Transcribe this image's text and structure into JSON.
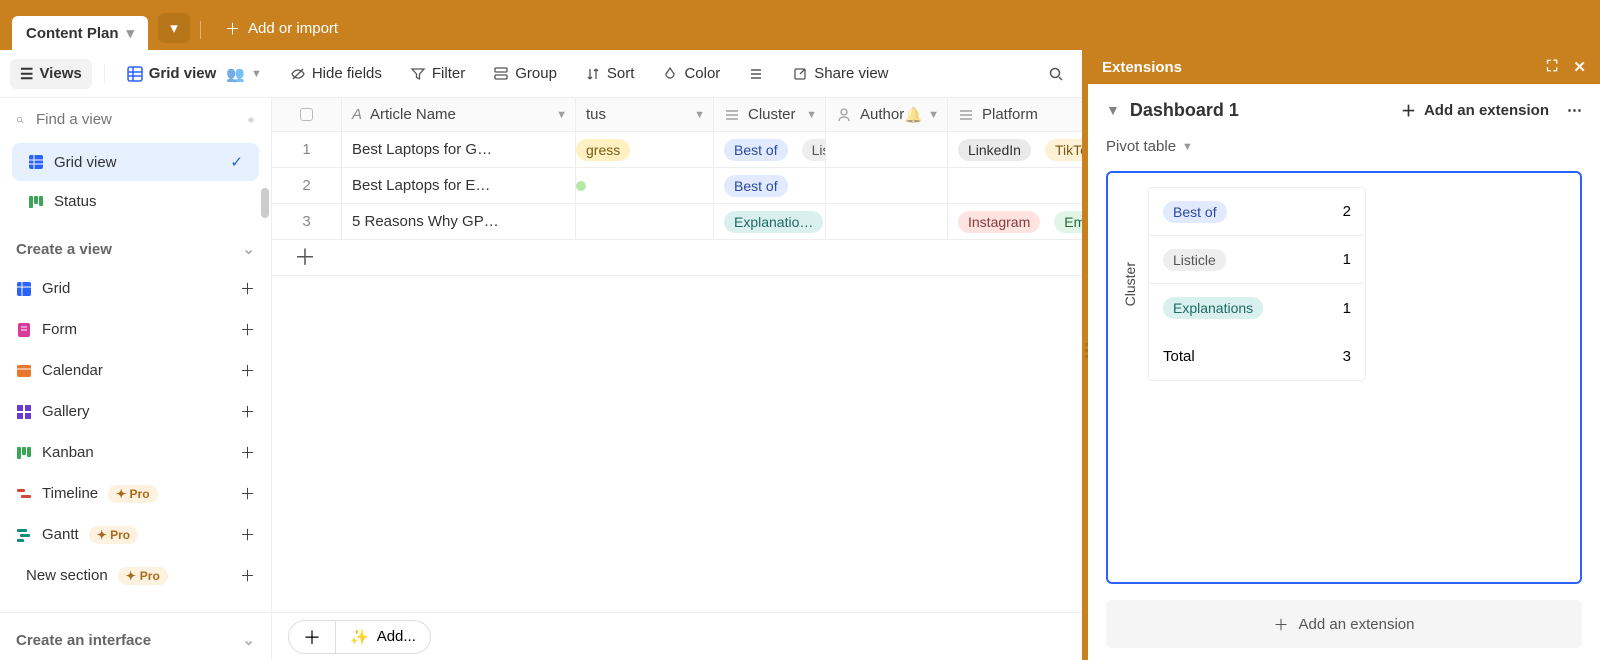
{
  "topbar": {
    "table_tab": "Content Plan",
    "add_or_import": "Add or import"
  },
  "toolbar": {
    "views": "Views",
    "grid_view": "Grid view",
    "hide_fields": "Hide fields",
    "filter": "Filter",
    "group": "Group",
    "sort": "Sort",
    "color": "Color",
    "share": "Share view"
  },
  "sidebar": {
    "search_placeholder": "Find a view",
    "views": [
      {
        "label": "Grid view",
        "active": true
      },
      {
        "label": "Status",
        "active": false
      }
    ],
    "create_view_header": "Create a view",
    "view_types": [
      {
        "label": "Grid",
        "color": "#2a62ff",
        "pro": false
      },
      {
        "label": "Form",
        "color": "#d63a9a",
        "pro": false
      },
      {
        "label": "Calendar",
        "color": "#e8762d",
        "pro": false
      },
      {
        "label": "Gallery",
        "color": "#6a3ad6",
        "pro": false
      },
      {
        "label": "Kanban",
        "color": "#3aa655",
        "pro": false
      },
      {
        "label": "Timeline",
        "color": "#d6453a",
        "pro": true
      },
      {
        "label": "Gantt",
        "color": "#0f8f79",
        "pro": true
      }
    ],
    "new_section": "New section",
    "pro_label": "Pro",
    "create_interface": "Create an interface"
  },
  "grid": {
    "columns": {
      "article_name": "Article Name",
      "status_partial": "tus",
      "cluster": "Cluster",
      "author": "Author",
      "platform": "Platform"
    },
    "rows": [
      {
        "num": "1",
        "name": "Best Laptops for G…",
        "status": {
          "text": "gress",
          "kind": "progress"
        },
        "cluster_tags": [
          {
            "text": "Best of",
            "kind": "bestof"
          },
          {
            "text": "Listi",
            "kind": "listicle"
          }
        ],
        "platform_tags": [
          {
            "text": "LinkedIn",
            "kind": "linkedin"
          },
          {
            "text": "TikTok",
            "kind": "tiktok"
          }
        ]
      },
      {
        "num": "2",
        "name": "Best Laptops for E…",
        "status": {
          "text": "",
          "kind": "done"
        },
        "cluster_tags": [
          {
            "text": "Best of",
            "kind": "bestof"
          }
        ],
        "platform_tags": []
      },
      {
        "num": "3",
        "name": "5 Reasons Why GP…",
        "status": {
          "text": "",
          "kind": ""
        },
        "cluster_tags": [
          {
            "text": "Explanatio…",
            "kind": "explain"
          }
        ],
        "platform_tags": [
          {
            "text": "Instagram",
            "kind": "instagram"
          },
          {
            "text": "Emai",
            "kind": "email"
          }
        ]
      }
    ],
    "footer_add": "Add..."
  },
  "extensions": {
    "title": "Extensions",
    "dashboard_title": "Dashboard 1",
    "add_extension": "Add an extension",
    "subtitle": "Pivot table",
    "row_label": "Cluster",
    "pivot": [
      {
        "label": "Best of",
        "kind": "bestof",
        "value": "2"
      },
      {
        "label": "Listicle",
        "kind": "listicle",
        "value": "1"
      },
      {
        "label": "Explanations",
        "kind": "explain",
        "value": "1"
      }
    ],
    "total_label": "Total",
    "total_value": "3",
    "big_add": "Add an extension"
  }
}
